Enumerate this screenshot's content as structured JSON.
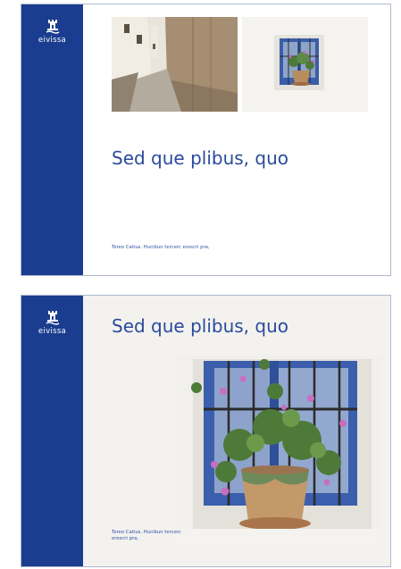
{
  "brand": {
    "logo_word": "eivissa"
  },
  "slides": [
    {
      "title": "Sed que plibus, quo",
      "footer": "Toreo Catius. Hucibun tercerc erescri pra,"
    },
    {
      "title": "Sed que plibus, quo",
      "footer": "Toreo Catius. Hucibun tercerc erescri pra,"
    }
  ],
  "colors": {
    "band": "#1b3d8f",
    "title": "#2a4a9c"
  },
  "images": [
    "old-town-street-photo",
    "window-flowerpot-photo",
    "window-flowerpot-photo-large"
  ]
}
